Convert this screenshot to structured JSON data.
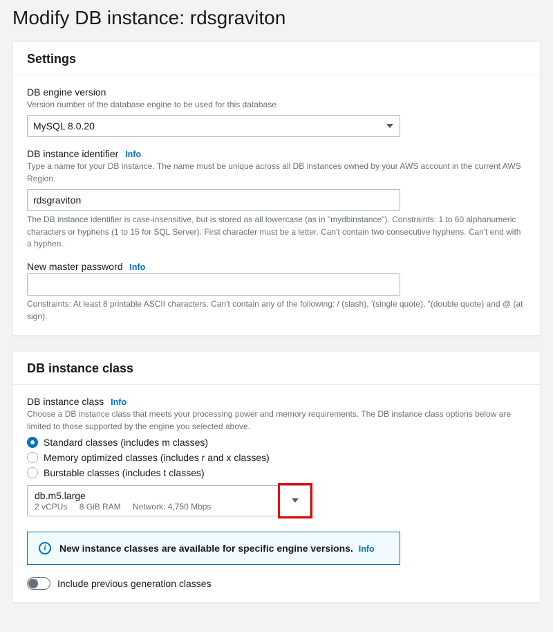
{
  "page_title": "Modify DB instance: rdsgraviton",
  "settings": {
    "panel_title": "Settings",
    "engine_version": {
      "label": "DB engine version",
      "desc": "Version number of the database engine to be used for this database",
      "value": "MySQL 8.0.20"
    },
    "identifier": {
      "label": "DB instance identifier",
      "info": "Info",
      "desc": "Type a name for your DB instance. The name must be unique across all DB instances owned by your AWS account in the current AWS Region.",
      "value": "rdsgraviton",
      "hint": "The DB instance identifier is case-insensitive, but is stored as all lowercase (as in \"mydbinstance\"). Constraints: 1 to 60 alphanumeric characters or hyphens (1 to 15 for SQL Server). First character must be a letter. Can't contain two consecutive hyphens. Can't end with a hyphen."
    },
    "master_password": {
      "label": "New master password",
      "info": "Info",
      "value": "",
      "hint": "Constraints: At least 8 printable ASCII characters. Can't contain any of the following: / (slash), '(single quote), \"(double quote) and @ (at sign)."
    }
  },
  "instance_class": {
    "panel_title": "DB instance class",
    "label": "DB instance class",
    "info": "Info",
    "desc": "Choose a DB instance class that meets your processing power and memory requirements. The DB instance class options below are limited to those supported by the engine you selected above.",
    "radios": [
      {
        "label": "Standard classes (includes m classes)",
        "selected": true
      },
      {
        "label": "Memory optimized classes (includes r and x classes)",
        "selected": false
      },
      {
        "label": "Burstable classes (includes t classes)",
        "selected": false
      }
    ],
    "selected": {
      "name": "db.m5.large",
      "vcpus": "2 vCPUs",
      "ram": "8 GiB RAM",
      "network": "Network: 4,750 Mbps"
    },
    "alert": {
      "text": "New instance classes are available for specific engine versions.",
      "info": "Info"
    },
    "toggle": {
      "label": "Include previous generation classes",
      "on": false
    }
  }
}
